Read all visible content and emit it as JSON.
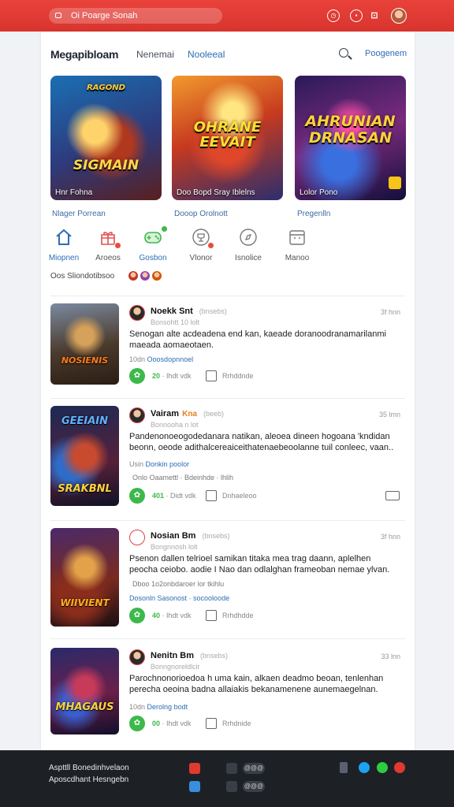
{
  "topbar": {
    "search_text": "Oi Poarge Sonah",
    "icons": [
      "clock-icon",
      "chat-icon",
      "mail-icon",
      "avatar"
    ]
  },
  "header": {
    "brand": "Megapibloam",
    "nav": [
      "Nenemai",
      "Nooleeal"
    ],
    "right_link": "Poogenem"
  },
  "featured": [
    {
      "art_title": "SIGMAIN",
      "art_top": "RAGOND",
      "caption": "Hnr Fohna",
      "sub": "Nlager Porrean"
    },
    {
      "art_title": "OHRANE EEVAIT",
      "caption": "Doo Bopd Sray Iblelns",
      "sub": "Dooop Orolnott"
    },
    {
      "art_title": "AHRUNIAN DRNASAN",
      "caption": "Lolor Pono",
      "sub": "Pregenlln"
    }
  ],
  "categories": [
    {
      "label": "Miopnen",
      "icon": "home-icon"
    },
    {
      "label": "Aroeos",
      "icon": "gift-icon"
    },
    {
      "label": "Gosbon",
      "icon": "controller-icon"
    },
    {
      "label": "Vlonor",
      "icon": "trophy-icon"
    },
    {
      "label": "Isnolice",
      "icon": "compass-icon"
    },
    {
      "label": "Manoo",
      "icon": "calendar-icon"
    }
  ],
  "online_label": "Oos Sliondotibsoo",
  "posts": [
    {
      "thumb_title": "NOSIENIS",
      "author": "Noekk Snt",
      "tag": "(bnsebs)",
      "handle": "Bonsohtt 10 lolt",
      "time": "3f hnn",
      "body": "Senogan alte acdeadena end kan, kaeade doranoodranamarilanmi maeada aomaeotaen.",
      "link_prefix": "10dn",
      "link": "Ooosdopnnoel",
      "likes": "20",
      "stat": "· Ihdt vdk",
      "comment": "Rrhddnde"
    },
    {
      "thumb_title": "GEEIAIN",
      "thumb_sub": "SRAKBNL",
      "author": "Vairam",
      "tag_hot": "Kna",
      "tag": "(beeb)",
      "handle": "Bonnooha n lot",
      "time": "35 lmn",
      "body": "Pandenonoeogodedanara natikan, aleoea dineen hogoana 'kndidan beonn, oeode adithalcereaiceithatenaebeoolanne tuil conleec, vaan..",
      "link_prefix": "Usin",
      "link": "Donkin poolor",
      "extra": "Onlo Oaamettl · Bdeinhde · lhlih",
      "likes": "401",
      "stat": "· Didt vdk",
      "comment": "Dnhaeleoo"
    },
    {
      "thumb_title": "WIIVIENT",
      "author": "Nosian Bm",
      "tag": "(bnsebs)",
      "handle": "Bongnnosh lolt",
      "time": "3f hnn",
      "body": "Psenon dallen telrioel samikan titaka mea trag daann, aplelhen peocha ceiobo. aodie I Nao dan odlalghan frameoban nemae ylvan.",
      "extra": "Dboo 1o2onbdaroer lor tkihlu",
      "link": "Dosonln Sasonost · socooloode",
      "likes": "40",
      "stat": "· Ihdt vdk",
      "comment": "Rrhdhdde"
    },
    {
      "thumb_title": "MHAGAUS",
      "author": "Nenitn Bm",
      "tag": "(bnsebs)",
      "handle": "Bonngnoreldlcir",
      "time": "33 lnn",
      "body": "Parochnonorioedoa h uma kain, alkaen deadmo beoan, tenlenhan perecha oeoina badna allaiakis bekanamenene aunemaegelnan.",
      "link_prefix": "10dn",
      "link": "Derolng bodt",
      "likes": "00",
      "stat": "· Ihdt vdk",
      "comment": "Rrhdnide"
    }
  ],
  "footer": {
    "line1": "Aspttll Bonedinhvelaon",
    "line2": "Aposcdhant Hesngebn",
    "pills": [
      "@@@",
      "@@@"
    ]
  },
  "colors": {
    "accent": "#e0392f",
    "link": "#2c6db6",
    "like": "#3db84b",
    "footer": "#1d2126"
  }
}
